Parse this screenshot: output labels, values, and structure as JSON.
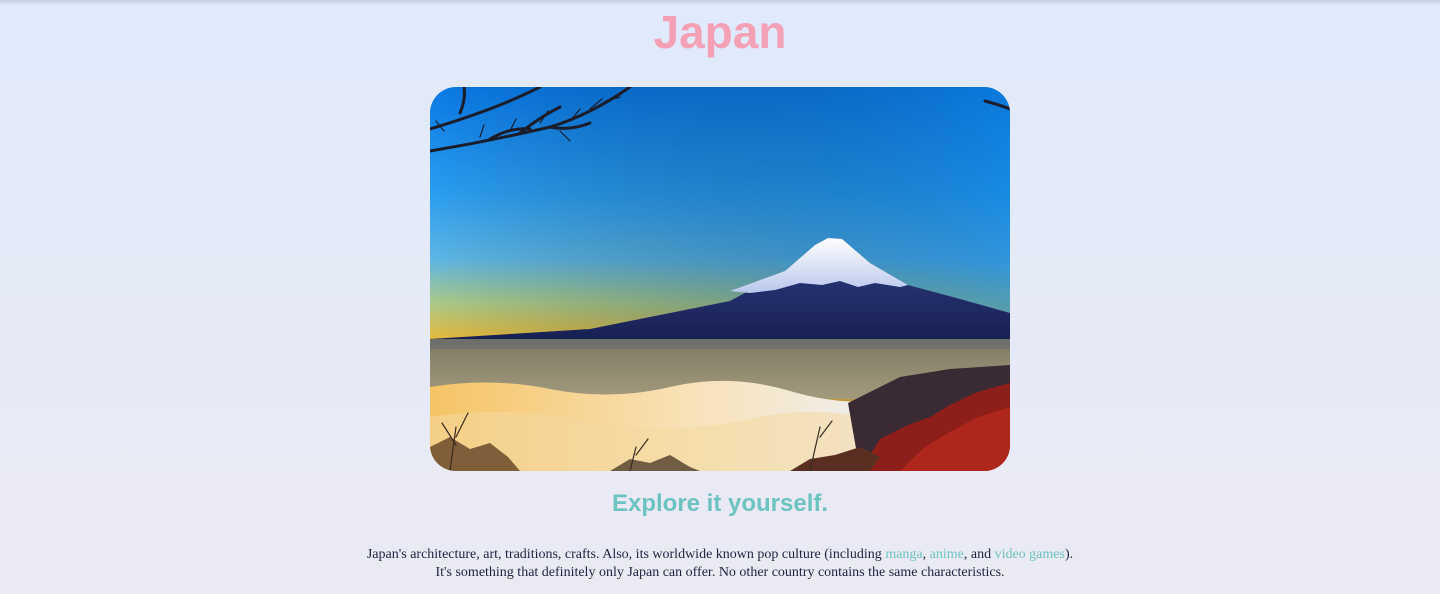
{
  "page": {
    "title": "Japan",
    "subtitle": "Explore it yourself.",
    "description": {
      "line1_start": "Japan's architecture, art, traditions, crafts. Also, its worldwide known pop culture (including ",
      "link_manga": "manga",
      "sep1": ", ",
      "link_anime": "anime",
      "sep2": ", and ",
      "link_video_games": "video games",
      "line1_end": ").",
      "line2": "It's something that definitely only Japan can offer. No other country contains the same characteristics."
    }
  },
  "colors": {
    "title": "#f4a1b6",
    "accent": "#6cc3c1",
    "text": "#1c2340",
    "background": "#e3eafa"
  },
  "hero_image": {
    "subject": "mount-fuji-sunrise-photo"
  }
}
